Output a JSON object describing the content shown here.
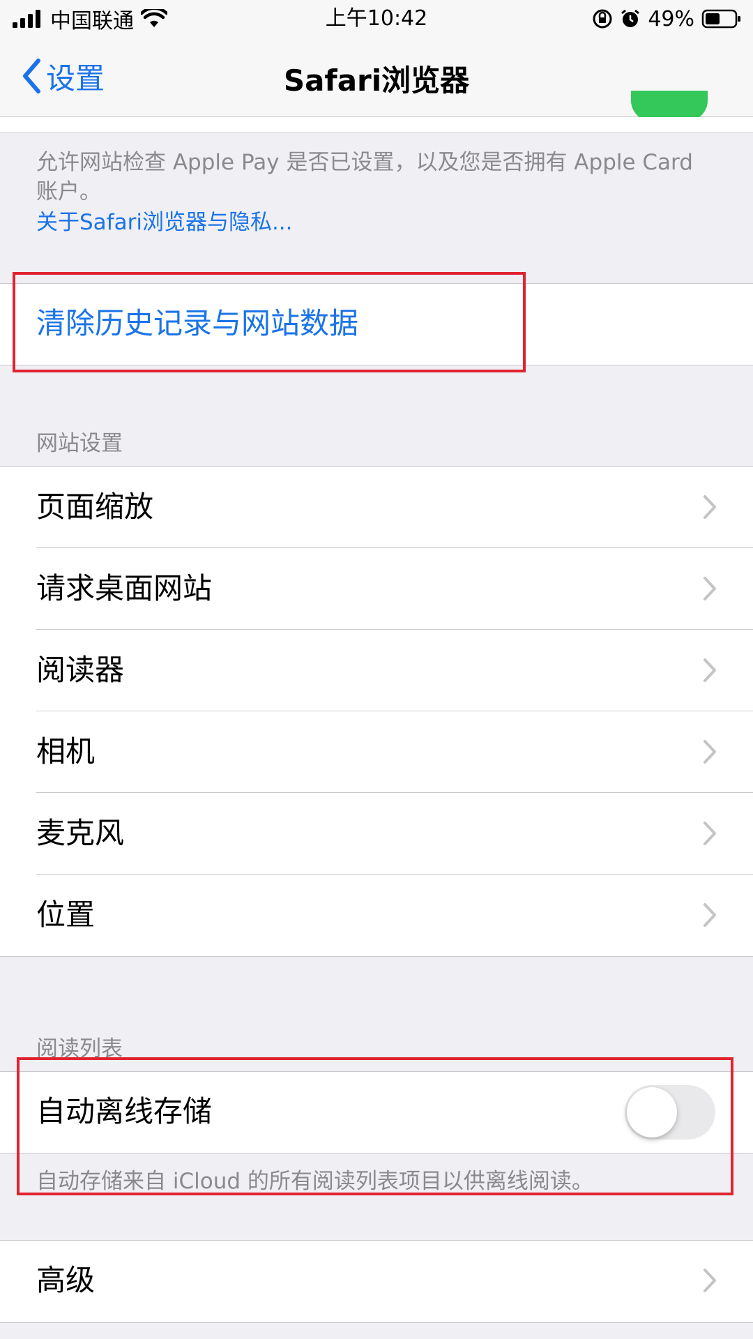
{
  "status_bar": {
    "carrier": "中国联通",
    "time": "上午10:42",
    "battery": "49%",
    "icons": [
      "signal-icon",
      "wifi-icon",
      "orientation-lock-icon",
      "alarm-icon",
      "battery-icon"
    ]
  },
  "nav": {
    "back_label": "设置",
    "title": "Safari浏览器"
  },
  "privacy": {
    "footnote": "允许网站检查 Apple Pay 是否已设置，以及您是否拥有 Apple Card账户。",
    "link": "关于Safari浏览器与隐私..."
  },
  "clear_history": {
    "label": "清除历史记录与网站数据"
  },
  "website_settings": {
    "header": "网站设置",
    "items": [
      {
        "label": "页面缩放"
      },
      {
        "label": "请求桌面网站"
      },
      {
        "label": "阅读器"
      },
      {
        "label": "相机"
      },
      {
        "label": "麦克风"
      },
      {
        "label": "位置"
      }
    ]
  },
  "reading_list": {
    "header": "阅读列表",
    "toggle_label": "自动离线存储",
    "toggle_on": false,
    "footnote": "自动存储来自 iCloud 的所有阅读列表项目以供离线阅读。"
  },
  "advanced": {
    "label": "高级"
  },
  "colors": {
    "accent": "#1a73e8",
    "highlight": "#e0242f",
    "toggle_on": "#34c759",
    "background": "#efeff4"
  }
}
